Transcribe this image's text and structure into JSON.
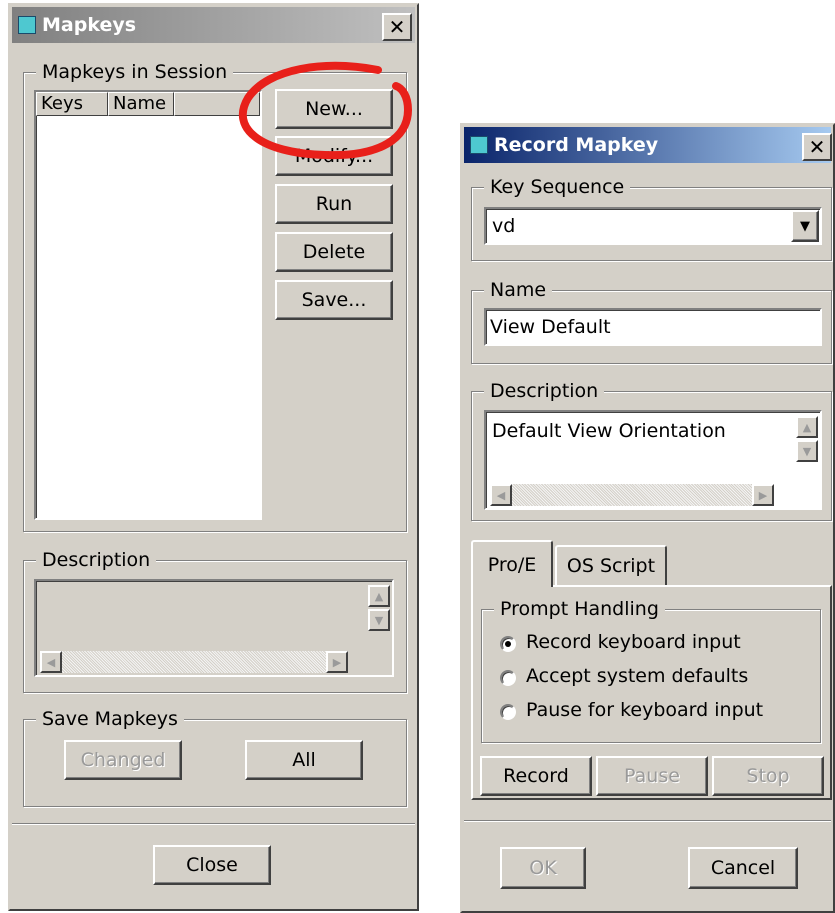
{
  "mapkeys": {
    "title": "Mapkeys",
    "close_icon": "close-x-icon",
    "session_group": "Mapkeys in Session",
    "columns": [
      "Keys",
      "Name",
      ""
    ],
    "buttons": {
      "new": "New...",
      "modify": "Modify...",
      "run": "Run",
      "delete": "Delete",
      "save": "Save..."
    },
    "description_group": "Description",
    "description_text": "",
    "save_group": "Save Mapkeys",
    "changed": "Changed",
    "all": "All",
    "close": "Close"
  },
  "record": {
    "title": "Record Mapkey",
    "key_sequence_group": "Key Sequence",
    "key_sequence_value": "vd",
    "name_group": "Name",
    "name_value": "View Default",
    "description_group": "Description",
    "description_value": "Default View Orientation",
    "tabs": [
      "Pro/E",
      "OS Script"
    ],
    "prompt_group": "Prompt Handling",
    "radios": [
      "Record keyboard input",
      "Accept system defaults",
      "Pause for keyboard input"
    ],
    "selected_radio": 0,
    "record_btn": "Record",
    "pause_btn": "Pause",
    "stop_btn": "Stop",
    "ok_btn": "OK",
    "cancel_btn": "Cancel"
  },
  "colors": {
    "title_active_start": "#0a246a",
    "title_active_end": "#a6caf0",
    "title_inactive_start": "#808080",
    "title_inactive_end": "#c0c0c0",
    "annotation_circle": "#e8201a"
  }
}
